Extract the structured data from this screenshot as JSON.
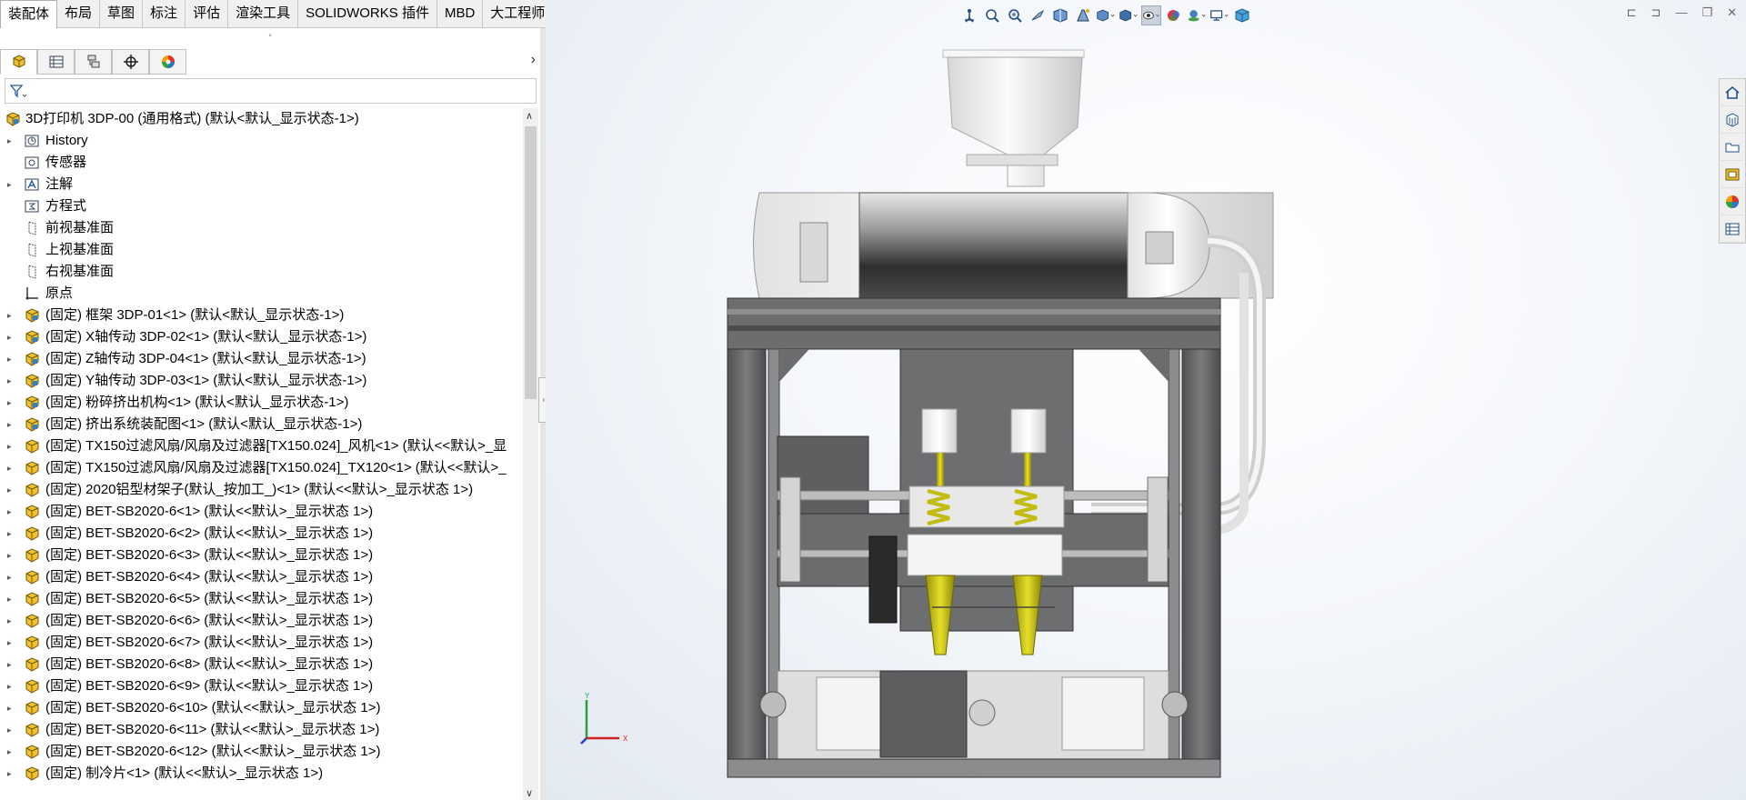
{
  "ribbon": {
    "tabs": [
      {
        "label": "装配体",
        "active": true
      },
      {
        "label": "布局"
      },
      {
        "label": "草图"
      },
      {
        "label": "标注"
      },
      {
        "label": "评估"
      },
      {
        "label": "渲染工具"
      },
      {
        "label": "SOLIDWORKS 插件"
      },
      {
        "label": "MBD"
      },
      {
        "label": "大工程师"
      }
    ]
  },
  "panel": {
    "tabs": [
      "feature-manager-icon",
      "property-manager-icon",
      "configuration-manager-icon",
      "dimxpert-icon",
      "display-manager-icon"
    ],
    "expand_arrow": "›",
    "filter_icon": "filter-icon"
  },
  "tree": {
    "root": "3D打印机 3DP-00  (通用格式)    (默认<默认_显示状态-1>)",
    "items": [
      {
        "label": "History",
        "icon": "history",
        "expandable": true
      },
      {
        "label": "传感器",
        "icon": "sensor",
        "expandable": false
      },
      {
        "label": "注解",
        "icon": "annotation",
        "expandable": true
      },
      {
        "label": "方程式",
        "icon": "equation",
        "expandable": false
      },
      {
        "label": "前视基准面",
        "icon": "plane",
        "expandable": false
      },
      {
        "label": "上视基准面",
        "icon": "plane",
        "expandable": false
      },
      {
        "label": "右视基准面",
        "icon": "plane",
        "expandable": false
      },
      {
        "label": "原点",
        "icon": "origin",
        "expandable": false
      },
      {
        "label": "(固定) 框架 3DP-01<1> (默认<默认_显示状态-1>)",
        "icon": "assembly",
        "expandable": true
      },
      {
        "label": "(固定) X轴传动 3DP-02<1> (默认<默认_显示状态-1>)",
        "icon": "assembly",
        "expandable": true
      },
      {
        "label": "(固定) Z轴传动 3DP-04<1> (默认<默认_显示状态-1>)",
        "icon": "assembly",
        "expandable": true
      },
      {
        "label": "(固定) Y轴传动 3DP-03<1> (默认<默认_显示状态-1>)",
        "icon": "assembly",
        "expandable": true
      },
      {
        "label": "(固定) 粉碎挤出机构<1> (默认<默认_显示状态-1>)",
        "icon": "assembly",
        "expandable": true
      },
      {
        "label": "(固定) 挤出系统装配图<1> (默认<默认_显示状态-1>)",
        "icon": "assembly",
        "expandable": true
      },
      {
        "label": "(固定) TX150过滤风扇/风扇及过滤器[TX150.024]_风机<1> (默认<<默认>_显",
        "icon": "part",
        "expandable": true
      },
      {
        "label": "(固定) TX150过滤风扇/风扇及过滤器[TX150.024]_TX120<1> (默认<<默认>_",
        "icon": "part",
        "expandable": true
      },
      {
        "label": "(固定) 2020铝型材架子(默认_按加工_)<1> (默认<<默认>_显示状态 1>)",
        "icon": "part",
        "expandable": true
      },
      {
        "label": "(固定) BET-SB2020-6<1> (默认<<默认>_显示状态 1>)",
        "icon": "part",
        "expandable": true
      },
      {
        "label": "(固定) BET-SB2020-6<2> (默认<<默认>_显示状态 1>)",
        "icon": "part",
        "expandable": true
      },
      {
        "label": "(固定) BET-SB2020-6<3> (默认<<默认>_显示状态 1>)",
        "icon": "part",
        "expandable": true
      },
      {
        "label": "(固定) BET-SB2020-6<4> (默认<<默认>_显示状态 1>)",
        "icon": "part",
        "expandable": true
      },
      {
        "label": "(固定) BET-SB2020-6<5> (默认<<默认>_显示状态 1>)",
        "icon": "part",
        "expandable": true
      },
      {
        "label": "(固定) BET-SB2020-6<6> (默认<<默认>_显示状态 1>)",
        "icon": "part",
        "expandable": true
      },
      {
        "label": "(固定) BET-SB2020-6<7> (默认<<默认>_显示状态 1>)",
        "icon": "part",
        "expandable": true
      },
      {
        "label": "(固定) BET-SB2020-6<8> (默认<<默认>_显示状态 1>)",
        "icon": "part",
        "expandable": true
      },
      {
        "label": "(固定) BET-SB2020-6<9> (默认<<默认>_显示状态 1>)",
        "icon": "part",
        "expandable": true
      },
      {
        "label": "(固定) BET-SB2020-6<10> (默认<<默认>_显示状态 1>)",
        "icon": "part",
        "expandable": true
      },
      {
        "label": "(固定) BET-SB2020-6<11> (默认<<默认>_显示状态 1>)",
        "icon": "part",
        "expandable": true
      },
      {
        "label": "(固定) BET-SB2020-6<12> (默认<<默认>_显示状态 1>)",
        "icon": "part",
        "expandable": true
      },
      {
        "label": "(固定) 制冷片<1> (默认<<默认>_显示状态 1>)",
        "icon": "part",
        "expandable": true
      }
    ]
  },
  "viewport": {
    "hud_icons": [
      "view-orientation-icon",
      "zoom-to-fit-icon",
      "zoom-area-icon",
      "previous-view-icon",
      "section-view-icon",
      "dynamic-annotation-icon",
      "view-orientation-dropdown-icon",
      "display-style-icon",
      "hide-show-icon",
      "edit-appearance-icon",
      "scenes-icon",
      "view-settings-icon",
      "cube-icon"
    ],
    "triad": {
      "x": "X",
      "y": "Y"
    },
    "task_pane_icons": [
      "home-icon",
      "design-library-icon",
      "file-explorer-icon",
      "view-palette-icon",
      "appearances-icon",
      "custom-properties-icon"
    ],
    "colors": {
      "frame": "#5f6163",
      "nozzle": "#c8c20c",
      "hopper": "#f2f2f2",
      "motor": "#3a3a3a"
    }
  }
}
